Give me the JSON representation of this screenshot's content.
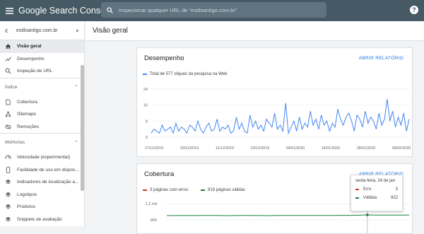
{
  "topbar": {
    "title_google": "Google",
    "title_product": "Search Console",
    "search_placeholder": "Inspecionar qualquer URL de \"estiloantigo.com.br\"",
    "help_icon": "help-icon"
  },
  "sidebar": {
    "property": "estiloantigo.com.br",
    "items_top": [
      {
        "label": "Visão geral",
        "icon": "home-icon",
        "active": true
      },
      {
        "label": "Desempenho",
        "icon": "trend-icon"
      },
      {
        "label": "Inspeção de URL",
        "icon": "search-icon"
      }
    ],
    "section_index": "Índice",
    "items_index": [
      {
        "label": "Cobertura",
        "icon": "document-icon"
      },
      {
        "label": "Sitemaps",
        "icon": "sitemap-icon"
      },
      {
        "label": "Remoções",
        "icon": "visibility-off-icon"
      }
    ],
    "section_improvements": "Melhorias",
    "items_improvements": [
      {
        "label": "Velocidade (experimental)",
        "icon": "speed-icon"
      },
      {
        "label": "Facilidade de uso em dispos...",
        "icon": "phone-icon"
      },
      {
        "label": "Indicadores de localização a...",
        "icon": "layers-icon"
      },
      {
        "label": "Logotipos",
        "icon": "layers-icon"
      },
      {
        "label": "Produtos",
        "icon": "layers-icon"
      },
      {
        "label": "Snippets de avaliação",
        "icon": "layers-icon"
      }
    ]
  },
  "main": {
    "title": "Visão geral"
  },
  "performance": {
    "title": "Desempenho",
    "link": "ABRIR RELATÓRIO",
    "legend": "Total de 577 cliques da pesquisa na Web",
    "color": "#4285f4"
  },
  "coverage": {
    "title": "Cobertura",
    "link": "ABRIR RELATÓRIO",
    "legend_errors": "3 páginas com erros",
    "legend_valid": "919 páginas válidas",
    "error_color": "#d93025",
    "valid_color": "#188038",
    "tooltip": {
      "date": "sexta-feira, 24 de jan",
      "error_label": "Erro",
      "error_value": "3",
      "valid_label": "Válidas",
      "valid_value": "922"
    }
  },
  "chart_data": [
    {
      "type": "line",
      "title": "Desempenho",
      "series": [
        {
          "name": "Total de 577 cliques da pesquisa na Web",
          "values": [
            2,
            4,
            3,
            2,
            6,
            3,
            4,
            5,
            2,
            7,
            3,
            5,
            4,
            2,
            6,
            5,
            3,
            8,
            4,
            2,
            5,
            7,
            3,
            4,
            9,
            3,
            5,
            4,
            6,
            2,
            3,
            10,
            4,
            7,
            3,
            2,
            11,
            5,
            8,
            4,
            6,
            3,
            9,
            7,
            5,
            12,
            4,
            6,
            3,
            17,
            2,
            5,
            8,
            3,
            10,
            4,
            7,
            5,
            13,
            6,
            9,
            4,
            11,
            6,
            8,
            3,
            7,
            5,
            14,
            9,
            6,
            10,
            12,
            8,
            3,
            11,
            9,
            5,
            13,
            7,
            10,
            8,
            4,
            12,
            6,
            9,
            19,
            8,
            13,
            5,
            10,
            6,
            12,
            3,
            9
          ]
        }
      ],
      "x_tick_labels": [
        "17/11/2019",
        "29/11/2019",
        "11/12/2019",
        "23/12/2019",
        "04/01/2020",
        "16/01/2020",
        "28/01/2020",
        "09/02/2020"
      ],
      "y_tick_labels": [
        "24",
        "16",
        "8",
        "0"
      ],
      "ylim": [
        0,
        24
      ]
    },
    {
      "type": "line",
      "title": "Cobertura",
      "series": [
        {
          "name": "3 páginas com erros",
          "values": [
            3,
            3,
            3,
            3,
            3,
            3,
            3,
            3,
            3,
            3,
            3,
            3,
            3,
            3,
            3,
            3,
            3,
            3,
            3,
            3,
            3,
            3,
            3,
            3,
            3,
            3,
            3,
            3,
            3,
            3
          ]
        },
        {
          "name": "919 páginas válidas",
          "values": [
            905,
            906,
            908,
            906,
            907,
            909,
            907,
            905,
            906,
            908,
            907,
            906,
            905,
            907,
            908,
            909,
            910,
            908,
            907,
            909,
            910,
            911,
            912,
            914,
            922,
            916,
            917,
            918,
            919,
            919
          ]
        }
      ],
      "y_tick_labels": [
        "1,2 mil",
        "800"
      ],
      "ylim": [
        0,
        1200
      ]
    }
  ]
}
